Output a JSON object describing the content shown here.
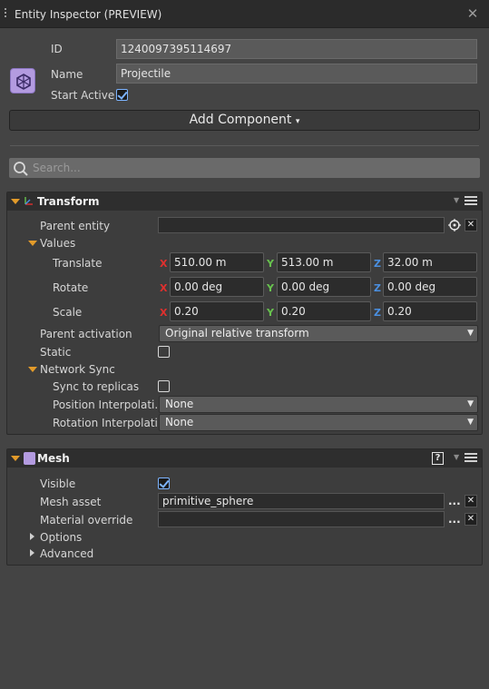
{
  "window": {
    "title": "Entity Inspector (PREVIEW)",
    "close_icon": "close-icon"
  },
  "entity": {
    "id_label": "ID",
    "id_value": "1240097395114697",
    "name_label": "Name",
    "name_value": "Projectile",
    "start_active_label": "Start Active",
    "start_active": true,
    "icon": "entity-icon"
  },
  "add_component": {
    "label": "Add Component",
    "caret": "▾"
  },
  "search": {
    "placeholder": "Search..."
  },
  "transform": {
    "title": "Transform",
    "parent_entity_label": "Parent entity",
    "parent_entity_value": "",
    "values_label": "Values",
    "translate_label": "Translate",
    "translate": {
      "x": "510.00 m",
      "y": "513.00 m",
      "z": "32.00 m"
    },
    "rotate_label": "Rotate",
    "rotate": {
      "x": "0.00 deg",
      "y": "0.00 deg",
      "z": "0.00 deg"
    },
    "scale_label": "Scale",
    "scale": {
      "x": "0.20",
      "y": "0.20",
      "z": "0.20"
    },
    "axis_labels": {
      "x": "X",
      "y": "Y",
      "z": "Z"
    },
    "parent_activation_label": "Parent activation",
    "parent_activation_value": "Original relative transform",
    "static_label": "Static",
    "static": false,
    "network_sync_label": "Network Sync",
    "sync_to_replicas_label": "Sync to replicas",
    "sync_to_replicas": false,
    "position_interp_label": "Position Interpolati...",
    "position_interp_value": "None",
    "rotation_interp_label": "Rotation Interpolati...",
    "rotation_interp_value": "None"
  },
  "mesh": {
    "title": "Mesh",
    "help_icon": "?",
    "visible_label": "Visible",
    "visible": true,
    "mesh_asset_label": "Mesh asset",
    "mesh_asset_value": "primitive_sphere",
    "material_override_label": "Material override",
    "material_override_value": "",
    "options_label": "Options",
    "advanced_label": "Advanced",
    "browse_label": "...",
    "clear_label": "✕"
  },
  "colors": {
    "accent_orange": "#e39b2a",
    "axis_x": "#e0302e",
    "axis_y": "#68c34e",
    "axis_z": "#4a8fe0",
    "checkbox_blue": "#7db4ff"
  }
}
